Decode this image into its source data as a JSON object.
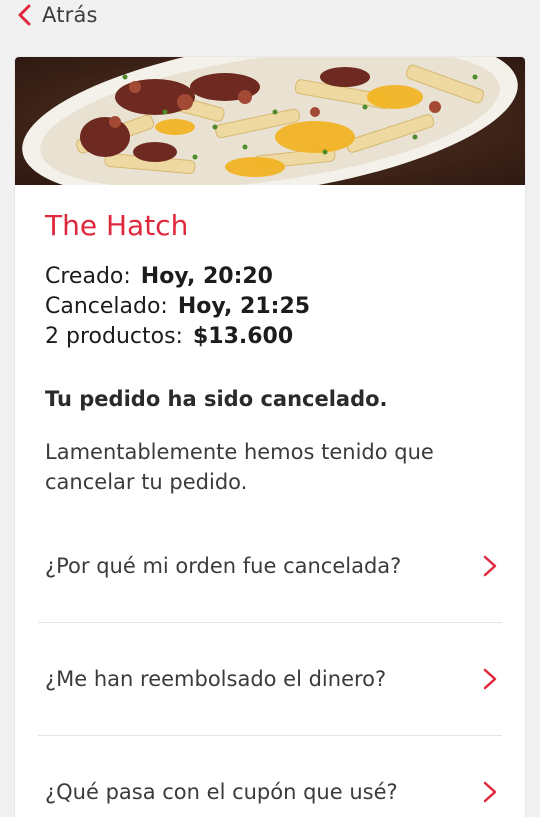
{
  "nav": {
    "back_label": "Atrás"
  },
  "colors": {
    "accent": "#e0283d",
    "background": "#f1f1f2"
  },
  "order": {
    "restaurant": "The Hatch",
    "created_label": "Creado:",
    "created_value": "Hoy, 20:20",
    "cancelled_label": "Cancelado:",
    "cancelled_value": "Hoy, 21:25",
    "items_label": "2 productos:",
    "items_total": "$13.600"
  },
  "status": {
    "title": "Tu pedido ha sido cancelado.",
    "body": "Lamentablemente hemos tenido que cancelar tu pedido."
  },
  "faq": [
    {
      "question": "¿Por qué mi orden fue cancelada?",
      "icon": "chevron-right-icon"
    },
    {
      "question": "¿Me han reembolsado el dinero?",
      "icon": "chevron-right-icon"
    },
    {
      "question": "¿Qué pasa con el cupón que usé?",
      "icon": "chevron-right-icon"
    }
  ]
}
